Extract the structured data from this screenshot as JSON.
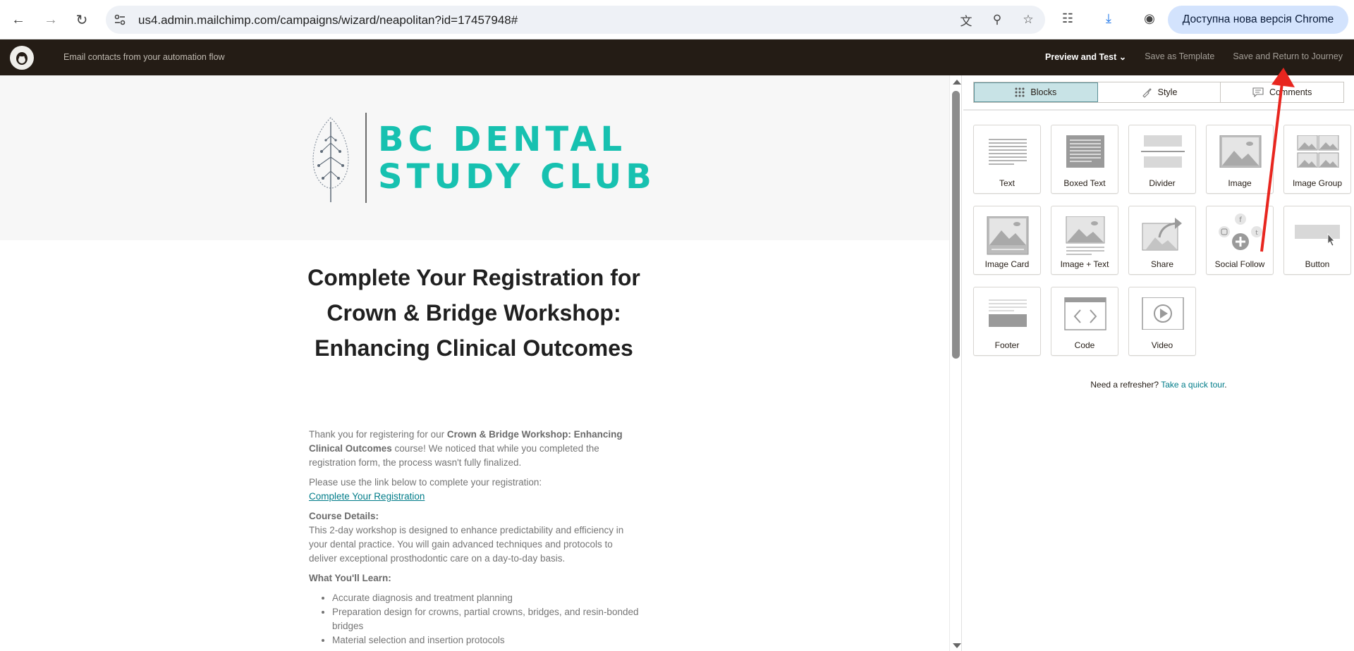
{
  "browser": {
    "url": "us4.admin.mailchimp.com/campaigns/wizard/neapolitan?id=17457948#",
    "update_label": "Доступна нова версія Chrome"
  },
  "mc_header": {
    "title": "Email contacts from your automation flow",
    "preview_label": "Preview and Test",
    "save_template_label": "Save as Template",
    "save_return_label": "Save and Return to Journey"
  },
  "email": {
    "logo_line1": "BC DENTAL",
    "logo_line2": "STUDY CLUB",
    "title": "Complete Your Registration for Crown & Bridge Workshop: Enhancing Clinical Outcomes",
    "p1_pre": "Thank you for registering for our ",
    "p1_bold": "Crown & Bridge Workshop: Enhancing Clinical Outcomes",
    "p1_post": " course! We noticed that while you completed the registration form, the process wasn't fully finalized.",
    "p2": "Please use the link below to complete your registration:",
    "link": "Complete Your Registration",
    "course_heading": "Course Details:",
    "course_text": "This 2-day workshop is designed to enhance predictability and efficiency in your dental practice. You will gain advanced techniques and protocols to deliver exceptional prosthodontic care on a day-to-day basis.",
    "learn_heading": "What You'll Learn:",
    "learn_items": [
      "Accurate diagnosis and treatment planning",
      "Preparation design for crowns, partial crowns, bridges, and resin-bonded bridges",
      "Material selection and insertion protocols"
    ]
  },
  "panel": {
    "tabs": [
      {
        "label": "Blocks",
        "icon": "grid-icon"
      },
      {
        "label": "Style",
        "icon": "brush-icon"
      },
      {
        "label": "Comments",
        "icon": "comment-icon"
      }
    ],
    "blocks": [
      {
        "label": "Text",
        "icon": "text-block-icon"
      },
      {
        "label": "Boxed Text",
        "icon": "boxed-text-block-icon"
      },
      {
        "label": "Divider",
        "icon": "divider-block-icon"
      },
      {
        "label": "Image",
        "icon": "image-block-icon"
      },
      {
        "label": "Image Group",
        "icon": "image-group-block-icon"
      },
      {
        "label": "Image Card",
        "icon": "image-card-block-icon"
      },
      {
        "label": "Image + Text",
        "icon": "image-text-block-icon"
      },
      {
        "label": "Share",
        "icon": "share-block-icon"
      },
      {
        "label": "Social Follow",
        "icon": "social-follow-block-icon"
      },
      {
        "label": "Button",
        "icon": "button-block-icon"
      },
      {
        "label": "Footer",
        "icon": "footer-block-icon"
      },
      {
        "label": "Code",
        "icon": "code-block-icon"
      },
      {
        "label": "Video",
        "icon": "video-block-icon"
      }
    ],
    "refresher_text": "Need a refresher? ",
    "refresher_link": "Take a quick tour",
    "refresher_end": "."
  },
  "colors": {
    "brand_header": "#241c15",
    "logo_teal": "#17c1b0",
    "active_tab": "#c8e3e6",
    "link": "#007c89",
    "annotation_arrow": "#e8261f"
  }
}
